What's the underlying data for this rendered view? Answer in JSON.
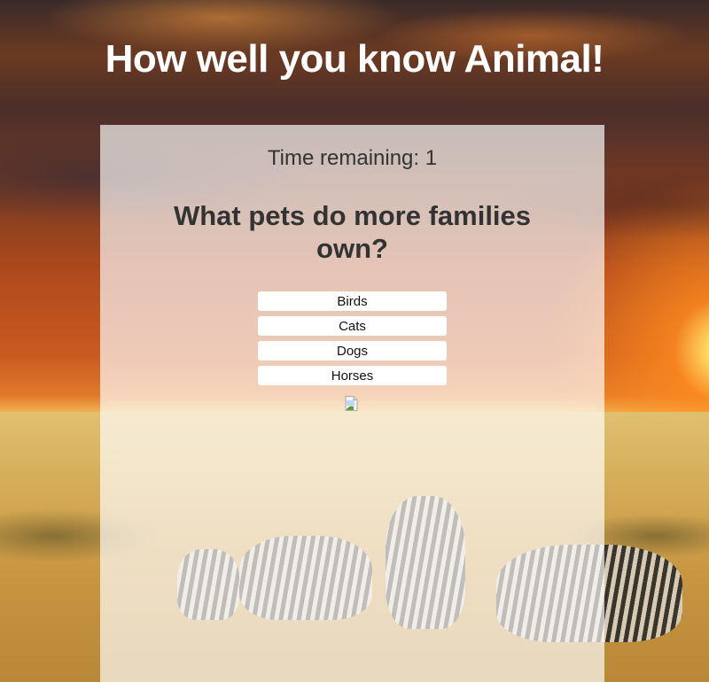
{
  "header": {
    "title": "How well you know Animal!"
  },
  "quiz": {
    "timer_label": "Time remaining: 1",
    "question": "What pets do more families own?",
    "answers": [
      "Birds",
      "Cats",
      "Dogs",
      "Horses"
    ]
  },
  "icons": {
    "broken_image": "broken-image-icon"
  }
}
